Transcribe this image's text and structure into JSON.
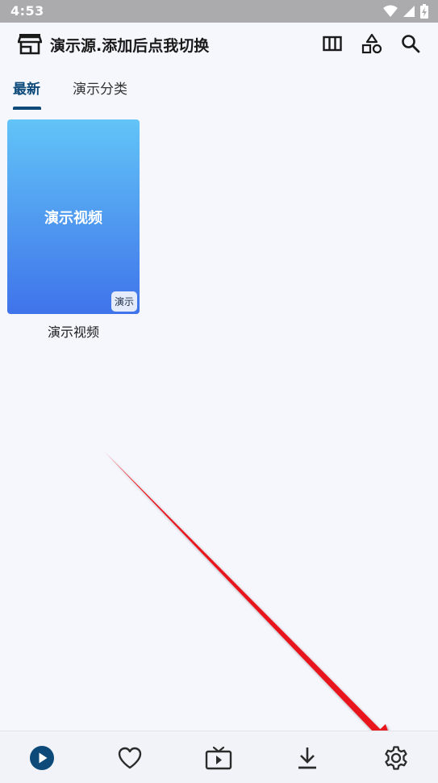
{
  "status_bar": {
    "time": "4:53",
    "icons": [
      "wifi-icon",
      "signal-icon",
      "battery-charging-icon"
    ]
  },
  "app_bar": {
    "title": "演示源.添加后点我切换",
    "actions": [
      "view-columns-icon",
      "categories-icon",
      "search-icon"
    ]
  },
  "tabs": [
    {
      "label": "最新",
      "active": true
    },
    {
      "label": "演示分类",
      "active": false
    }
  ],
  "videos": [
    {
      "cover_text": "演示视频",
      "badge": "演示",
      "title": "演示视频"
    }
  ],
  "bottom_nav": [
    {
      "icon": "play-circle-icon",
      "active": true
    },
    {
      "icon": "heart-icon",
      "active": false
    },
    {
      "icon": "tv-icon",
      "active": false
    },
    {
      "icon": "download-icon",
      "active": false
    },
    {
      "icon": "settings-icon",
      "active": false
    }
  ],
  "colors": {
    "accent": "#0D4A7A",
    "background": "#F6F7FD",
    "annotation_arrow": "#E8141C"
  }
}
